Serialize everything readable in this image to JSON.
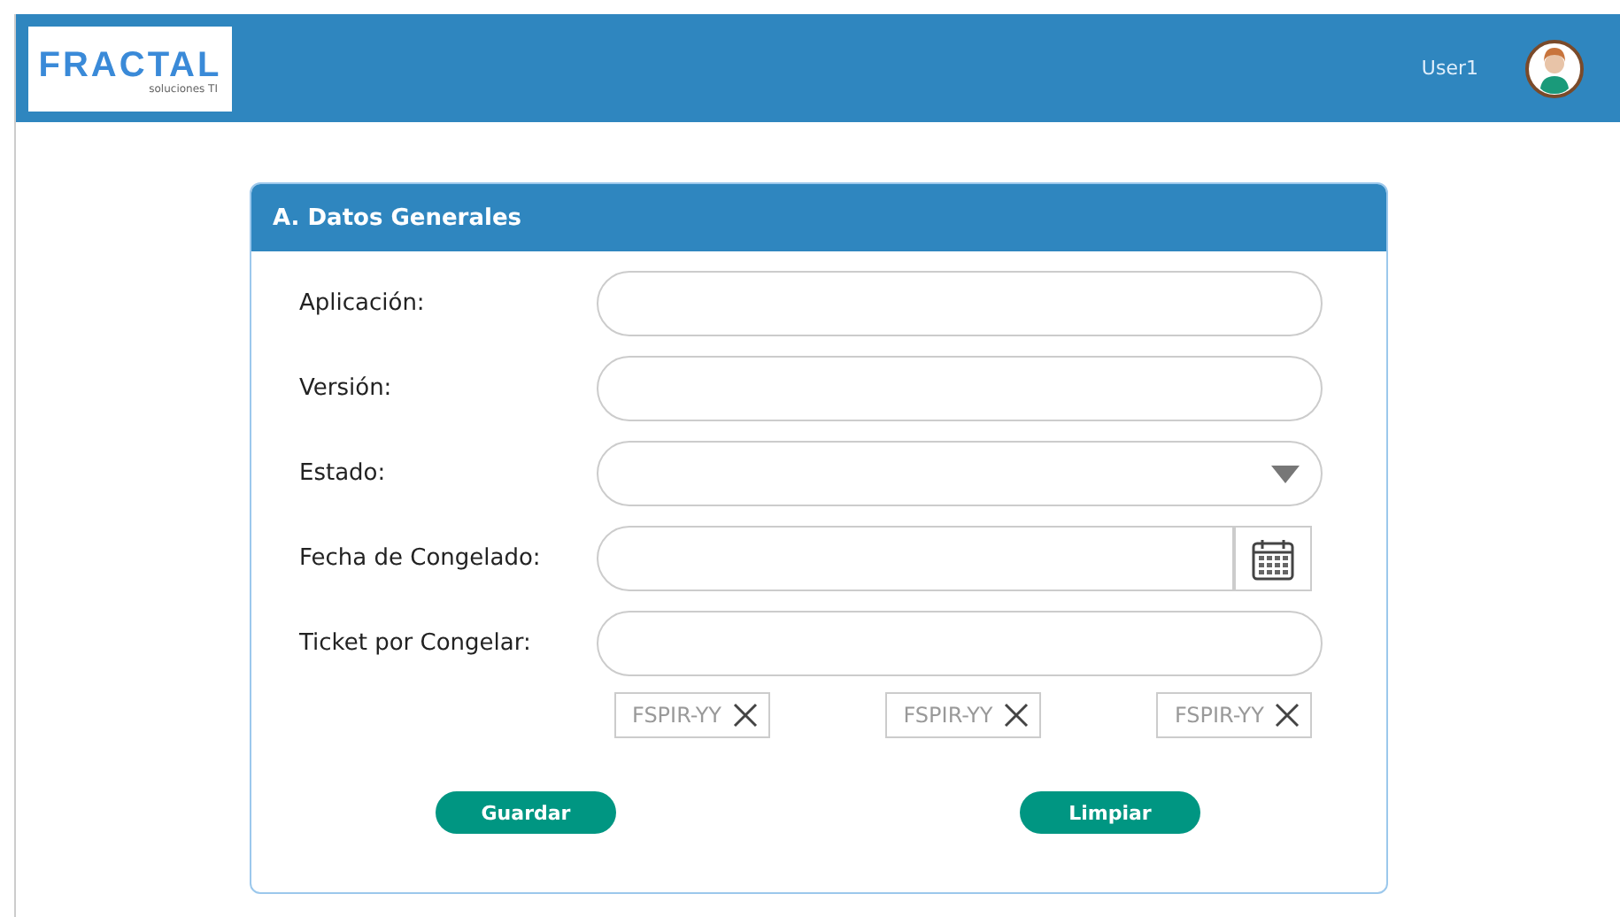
{
  "header": {
    "logo": {
      "name": "FRACTAL",
      "tagline": "soluciones TI"
    },
    "user": "User1"
  },
  "form": {
    "title": "A. Datos Generales",
    "fields": [
      {
        "label": "Aplicación:",
        "kind": "text"
      },
      {
        "label": "Versión:",
        "kind": "text"
      },
      {
        "label": "Estado:",
        "kind": "select"
      },
      {
        "label": "Fecha de Congelado:",
        "kind": "date"
      },
      {
        "label": "Ticket por Congelar:",
        "kind": "text"
      }
    ],
    "tags": [
      "FSPIR-YY",
      "FSPIR-YY",
      "FSPIR-YY"
    ],
    "buttons": [
      "Guardar",
      "Limpiar"
    ]
  }
}
